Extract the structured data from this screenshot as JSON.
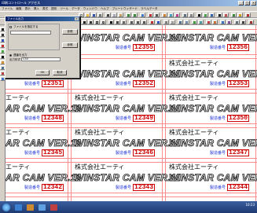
{
  "window": {
    "title": "印刷コントロール アクセス",
    "buttons": [
      "_",
      "□",
      "×"
    ]
  },
  "menu": [
    "ファイル",
    "編集",
    "表示",
    "挿入",
    "書式",
    "図形",
    "ツール",
    "データ",
    "ウィンドウ",
    "ヘルプ",
    "プレートウィザード",
    "ラベルデータ"
  ],
  "dialog": {
    "title": "ファイル出力",
    "close": "×",
    "checkbox_label": "ファイルを指定する",
    "browse_label": "参照",
    "browse2_label": "参照",
    "radio_label": "連番を出力",
    "select_label": "出力形式",
    "select_value": "CSV",
    "ok_label": "OK",
    "cancel_label": "取消"
  },
  "labels": {
    "company": "株式会社エーティ",
    "company_short": "エーティ",
    "product": "WINSTAR CAM VER.11",
    "product_short": "AR CAM VER.11",
    "serial_label": "製造番号"
  },
  "serials": {
    "row1": [
      "12355",
      "12356"
    ],
    "row2": [
      "12351",
      "12352",
      "12353"
    ],
    "row3": [
      "12348",
      "12349",
      "12350"
    ],
    "row4": [
      "12345",
      "12346",
      "12347"
    ],
    "row5": [
      "12342",
      "12343",
      "12344"
    ]
  },
  "colors": {
    "guide_line": "#ff8c8c",
    "serial_red": "#cc0000",
    "serial_label_blue": "#1a2fd6"
  },
  "taskbar": {
    "clock": "10:23"
  }
}
